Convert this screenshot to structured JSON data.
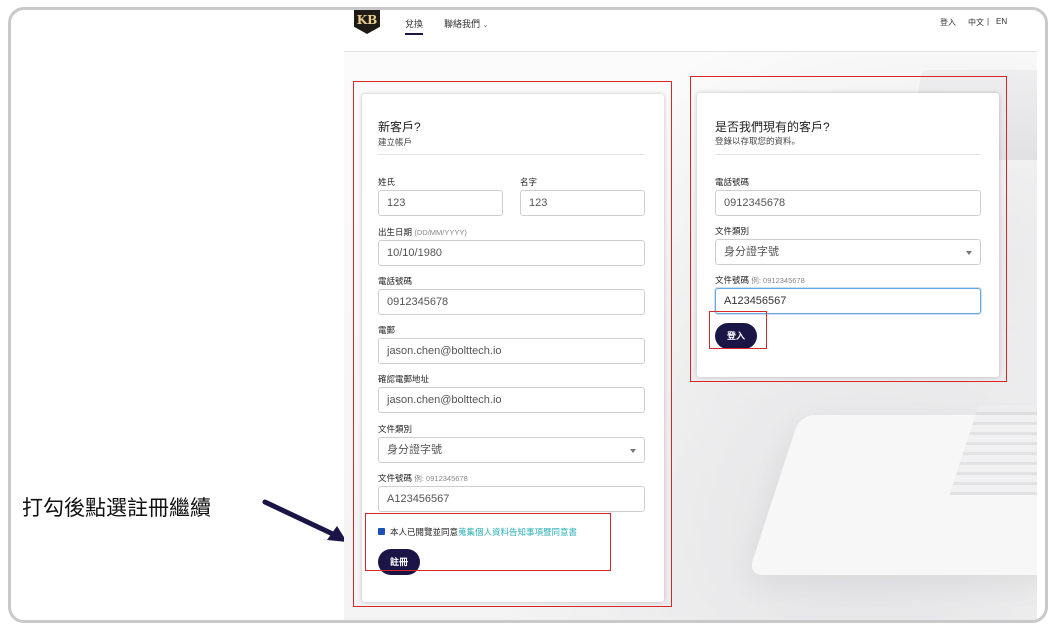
{
  "header": {
    "logo_text": "KB",
    "nav": {
      "home": "兌換",
      "contact": "聯絡我們"
    },
    "login": "登入",
    "lang_zh": "中文",
    "lang_sep": "|",
    "lang_en": "EN"
  },
  "register": {
    "title": "新客戶?",
    "subtitle": "建立帳戶",
    "last_name_label": "姓氏",
    "last_name_value": "123",
    "first_name_label": "名字",
    "first_name_value": "123",
    "dob_label": "出生日期",
    "dob_hint": "(DD/MM/YYYY)",
    "dob_value": "10/10/1980",
    "phone_label": "電話號碼",
    "phone_value": "0912345678",
    "email_label": "電郵",
    "email_value": "jason.chen@bolttech.io",
    "confirm_email_label": "確認電郵地址",
    "confirm_email_value": "jason.chen@bolttech.io",
    "doc_type_label": "文件類別",
    "doc_type_value": "身分證字號",
    "doc_number_label": "文件號碼",
    "doc_number_hint": "例: 0912345678",
    "doc_number_value": "A123456567",
    "consent_text": "本人已閱覽並同意",
    "consent_link": "蒐集個人資料告知事項暨同意書",
    "submit_label": "註冊"
  },
  "login": {
    "title": "是否我們現有的客戶?",
    "subtitle": "登錄以存取您的資料。",
    "phone_label": "電話號碼",
    "phone_value": "0912345678",
    "doc_type_label": "文件類別",
    "doc_type_value": "身分證字號",
    "doc_number_label": "文件號碼",
    "doc_number_hint": "例: 0912345678",
    "doc_number_value": "A123456567",
    "submit_label": "登入"
  },
  "annotation": {
    "text": "打勾後點選註冊繼續"
  },
  "colors": {
    "primary_button": "#1b1446",
    "highlight_box": "#d62828",
    "consent_link": "#2ab0b8"
  }
}
